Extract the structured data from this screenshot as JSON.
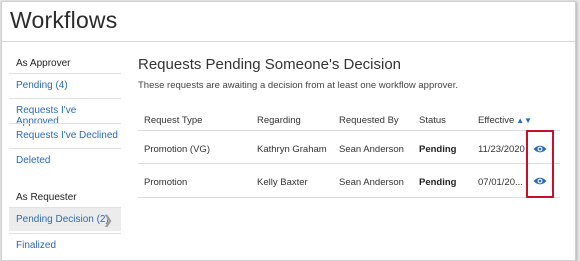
{
  "page": {
    "title": "Workflows"
  },
  "sidebar": {
    "approver_heading": "As Approver",
    "approver_items": [
      {
        "label": "Pending (4)"
      },
      {
        "label": "Requests I've Approved"
      },
      {
        "label": "Requests I've Declined"
      },
      {
        "label": "Deleted"
      }
    ],
    "requester_heading": "As Requester",
    "requester_items": [
      {
        "label": "Pending Decision (2)",
        "active": true
      },
      {
        "label": "Finalized"
      }
    ]
  },
  "main": {
    "heading": "Requests Pending Someone's Decision",
    "subtitle": "These requests are awaiting a decision from at least one workflow approver.",
    "columns": [
      "Request Type",
      "Regarding",
      "Requested By",
      "Status",
      "Effective"
    ],
    "sort_indicator": "▲▼",
    "rows": [
      {
        "request_type": "Promotion (VG)",
        "regarding": "Kathryn Graham",
        "requested_by": "Sean Anderson",
        "status": "Pending",
        "effective": "11/23/2020"
      },
      {
        "request_type": "Promotion",
        "regarding": "Kelly Baxter",
        "requested_by": "Sean Anderson",
        "status": "Pending",
        "effective": "07/01/20..."
      }
    ]
  },
  "colors": {
    "link": "#2a6bb4",
    "highlight": "#c8102e",
    "eye_icon": "#2a6bb4"
  }
}
